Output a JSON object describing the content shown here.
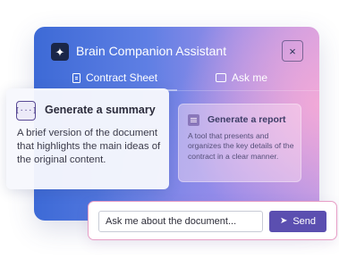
{
  "window": {
    "title": "Brain Companion Assistant",
    "logo_icon": "sparkle-icon",
    "close_glyph": "×"
  },
  "tabs": [
    {
      "label": "Contract Sheet",
      "icon": "document-icon",
      "active": true
    },
    {
      "label": "Ask me",
      "icon": "chat-icon",
      "active": false
    }
  ],
  "cards": {
    "summary": {
      "icon_glyph": "[···]",
      "title": "Generate a summary",
      "description": "A brief version of the document that highlights the main ideas of the original content."
    },
    "report": {
      "icon": "report-icon",
      "title": "Generate a report",
      "description": "A tool that presents and organizes the key details of the contract in a clear manner."
    }
  },
  "composer": {
    "placeholder": "Ask me about the document...",
    "send_label": "Send",
    "send_icon": "paper-plane-icon"
  },
  "colors": {
    "accent": "#5b4fb0",
    "input_border": "#e79ec6"
  }
}
